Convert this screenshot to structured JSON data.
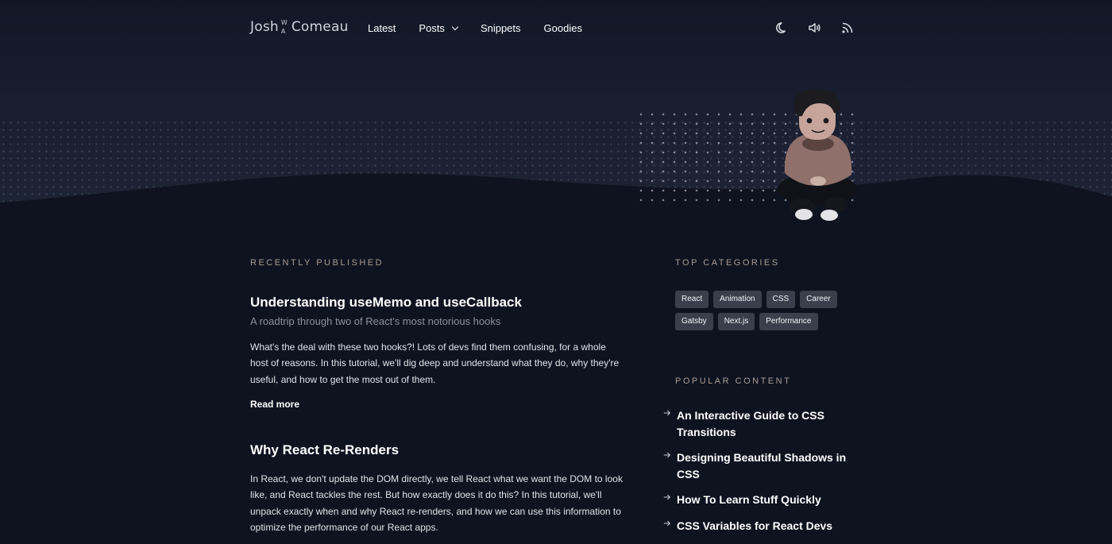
{
  "header": {
    "logo": {
      "first": "Josh",
      "mark_top": "W",
      "mark_bottom": "A",
      "last": "Comeau"
    },
    "nav": [
      {
        "label": "Latest"
      },
      {
        "label": "Posts"
      },
      {
        "label": "Snippets"
      },
      {
        "label": "Goodies"
      }
    ],
    "icons": [
      "moon-icon",
      "volume-icon",
      "rss-icon"
    ]
  },
  "recent": {
    "heading": "Recently Published",
    "posts": [
      {
        "title": "Understanding useMemo and useCallback",
        "subtitle": "A roadtrip through two of React's most notorious hooks",
        "excerpt": "What's the deal with these two hooks?! Lots of devs find them confusing, for a whole host of reasons. In this tutorial, we'll dig deep and understand what they do, why they're useful, and how to get the most out of them.",
        "read_more": "Read more"
      },
      {
        "title": "Why React Re-Renders",
        "excerpt": "In React, we don't update the DOM directly, we tell React what we want the DOM to look like, and React tackles the rest. But how exactly does it do this? In this tutorial, we'll unpack exactly when and why React re-renders, and how we can use this information to optimize the performance of our React apps."
      }
    ]
  },
  "categories": {
    "heading": "Top Categories",
    "tags": [
      "React",
      "Animation",
      "CSS",
      "Career",
      "Gatsby",
      "Next.js",
      "Performance"
    ]
  },
  "popular": {
    "heading": "Popular Content",
    "items": [
      "An Interactive Guide to CSS Transitions",
      "Designing Beautiful Shadows in CSS",
      "How To Learn Stuff Quickly",
      "CSS Variables for React Devs"
    ]
  },
  "colors": {
    "background": "#0f1320",
    "hero": "#1e2537",
    "tag_bg": "#3b3f4c",
    "section_label": "#a89d96"
  }
}
